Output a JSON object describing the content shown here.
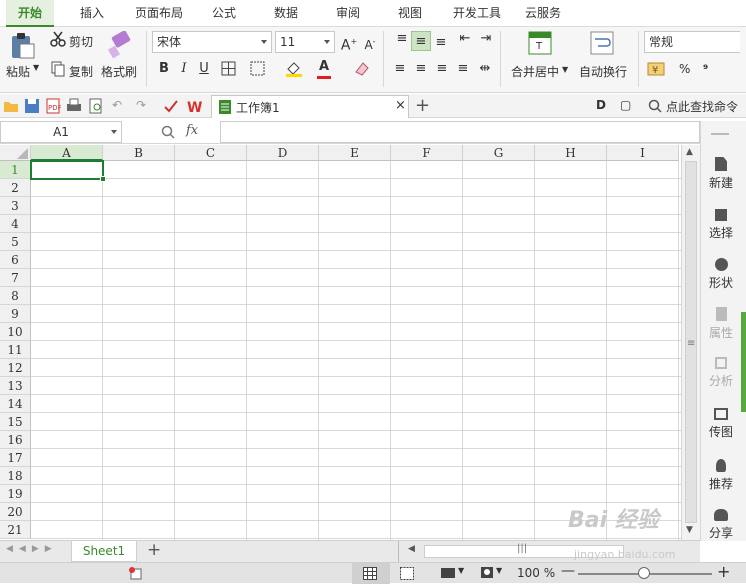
{
  "menu": {
    "tabs": [
      "开始",
      "插入",
      "页面布局",
      "公式",
      "数据",
      "审阅",
      "视图",
      "开发工具",
      "云服务"
    ]
  },
  "ribbon": {
    "clipboard": {
      "paste": "粘贴",
      "cut": "剪切",
      "copy": "复制",
      "format_painter": "格式刷"
    },
    "font": {
      "name": "宋体",
      "size": "11",
      "bold": "B",
      "italic": "I",
      "underline": "U",
      "font_color": "A"
    },
    "align": {
      "merge": "合并居中",
      "wrap": "自动换行"
    },
    "number": {
      "format": "常规",
      "percent": "%",
      "comma": "⁹"
    }
  },
  "quickbar": {
    "doc_title": "工作簿1",
    "search_label": "点此查找命令"
  },
  "formula": {
    "cell_ref": "A1",
    "fx": "fx",
    "value": ""
  },
  "grid": {
    "columns": [
      "A",
      "B",
      "C",
      "D",
      "E",
      "F",
      "G",
      "H",
      "I"
    ],
    "rows": [
      "1",
      "2",
      "3",
      "4",
      "5",
      "6",
      "7",
      "8",
      "9",
      "10",
      "11",
      "12",
      "13",
      "14",
      "15",
      "16",
      "17",
      "18",
      "19",
      "20",
      "21"
    ],
    "selected_cell": "A1"
  },
  "sidebar": {
    "items": [
      "新建",
      "选择",
      "形状",
      "属性",
      "分析",
      "传图",
      "推荐",
      "分享"
    ]
  },
  "sheets": {
    "tabs": [
      "Sheet1"
    ],
    "add": "+"
  },
  "status": {
    "zoom": "100 %"
  },
  "colors": {
    "accent": "#3a8a2a",
    "select": "#1e7d32",
    "header_sel": "#d9ead3"
  },
  "watermark": {
    "text": "Bai 经验",
    "sub": "jingyan.baidu.com"
  }
}
